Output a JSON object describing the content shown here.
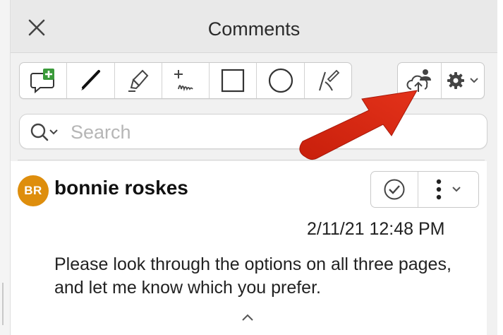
{
  "panel": {
    "title": "Comments"
  },
  "toolbar": {
    "tools": [
      {
        "name": "add-comment",
        "icon": "speech-bubble-plus-icon"
      },
      {
        "name": "pen",
        "icon": "pen-icon"
      },
      {
        "name": "highlighter",
        "icon": "highlighter-icon"
      },
      {
        "name": "freehand",
        "icon": "freehand-text-icon"
      },
      {
        "name": "rectangle",
        "icon": "rectangle-icon"
      },
      {
        "name": "ellipse",
        "icon": "ellipse-icon"
      },
      {
        "name": "signature",
        "icon": "signature-pen-icon"
      }
    ],
    "share_icon": "cloud-share-icon",
    "settings_icon": "gear-icon"
  },
  "search": {
    "placeholder": "Search"
  },
  "comment": {
    "avatar_initials": "BR",
    "author": "bonnie roskes",
    "date": "2/11/21 12:48 PM",
    "text": "Please look through the options on all three pages, and let me know which you prefer."
  },
  "colors": {
    "avatar": "#de8e0d",
    "add_comment_plus": "#3a9a3a",
    "annotation_arrow": "#d7260f"
  }
}
